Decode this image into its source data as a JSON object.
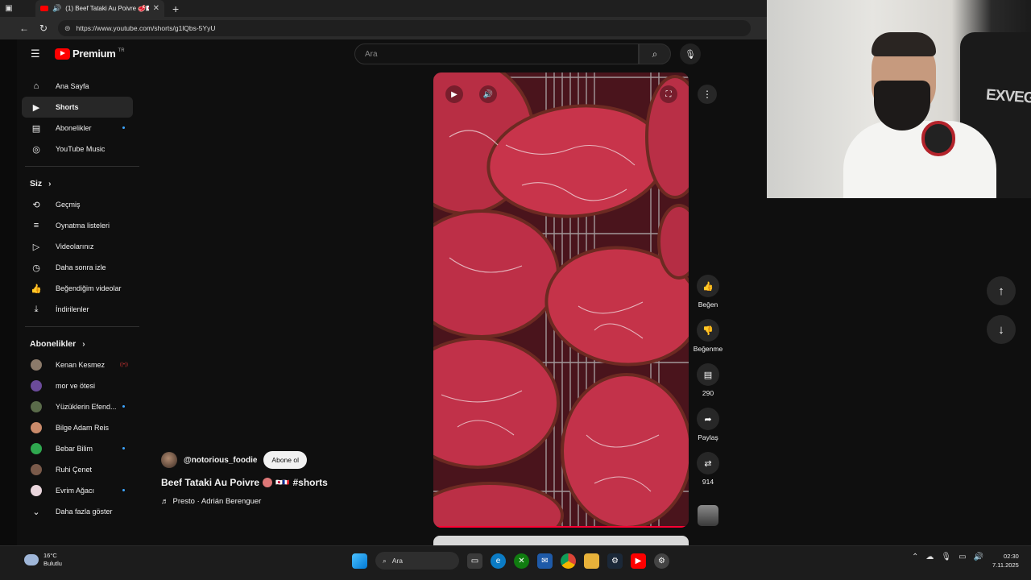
{
  "browser": {
    "tab_title": "(1) Beef Tataki Au Poivre 🥩🇯🇵🇫🇷 #shorts",
    "url": "https://www.youtube.com/shorts/g1lQbs-5YyU"
  },
  "youtube": {
    "brand": "Premium",
    "brand_sup": "TR",
    "search_placeholder": "Ara",
    "main_nav": [
      {
        "label": "Ana Sayfa",
        "icon": "home-icon"
      },
      {
        "label": "Shorts",
        "icon": "shorts-icon",
        "active": true
      },
      {
        "label": "Abonelikler",
        "icon": "subscriptions-icon",
        "dot": true
      },
      {
        "label": "YouTube Music",
        "icon": "music-icon"
      }
    ],
    "you_section": {
      "heading": "Siz",
      "items": [
        {
          "label": "Geçmiş",
          "icon": "history-icon"
        },
        {
          "label": "Oynatma listeleri",
          "icon": "playlist-icon"
        },
        {
          "label": "Videolarınız",
          "icon": "your-videos-icon"
        },
        {
          "label": "Daha sonra izle",
          "icon": "watch-later-icon"
        },
        {
          "label": "Beğendiğim videolar",
          "icon": "liked-icon"
        },
        {
          "label": "İndirilenler",
          "icon": "download-icon"
        }
      ]
    },
    "subscriptions": {
      "heading": "Abonelikler",
      "items": [
        {
          "label": "Kenan Kesmez",
          "color": "#8b7a6a",
          "live": true
        },
        {
          "label": "mor ve ötesi",
          "color": "#6b4b9a"
        },
        {
          "label": "Yüzüklerin Efend...",
          "color": "#5a6b4a",
          "dot": true
        },
        {
          "label": "Bilge Adam Reis",
          "color": "#c98a6a"
        },
        {
          "label": "Bebar Bilim",
          "color": "#2fa84f",
          "dot": true
        },
        {
          "label": "Ruhi Çenet",
          "color": "#7a5a4a"
        },
        {
          "label": "Evrim Ağacı",
          "color": "#e9d5dc",
          "dot": true
        }
      ],
      "show_more": "Daha fazla göster"
    },
    "short": {
      "channel": "@notorious_foodie",
      "subscribe": "Abone ol",
      "title": "Beef Tataki Au Poivre",
      "title_flags": "🇯🇵🇫🇷",
      "title_tag": "#shorts",
      "music": "Presto · Adrián Berenguer"
    },
    "actions": [
      {
        "label": "Beğen",
        "icon": "like-icon"
      },
      {
        "label": "Beğenme",
        "icon": "dislike-icon"
      },
      {
        "label": "290",
        "icon": "comment-icon"
      },
      {
        "label": "Paylaş",
        "icon": "share-icon"
      },
      {
        "label": "914",
        "icon": "remix-icon"
      }
    ]
  },
  "webcam": {
    "chair_text": "EXVEGA"
  },
  "taskbar": {
    "temp": "16°C",
    "weather": "Bulutlu",
    "search": "Ara",
    "time": "02:30",
    "date": "7.11.2025"
  }
}
